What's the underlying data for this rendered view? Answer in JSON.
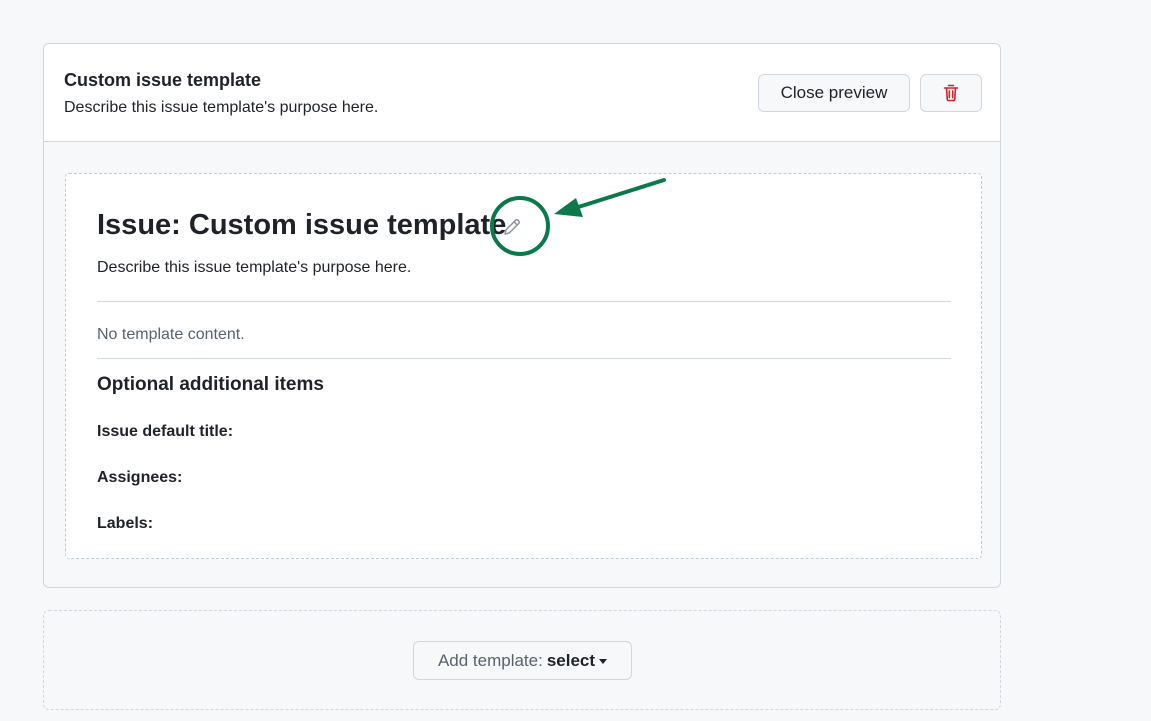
{
  "template": {
    "title": "Custom issue template",
    "description": "Describe this issue template's purpose here.",
    "close_preview_label": "Close preview",
    "delete_icon": "trash-icon"
  },
  "preview": {
    "title": "Issue: Custom issue template",
    "edit_icon": "pencil-icon",
    "description": "Describe this issue template's purpose here.",
    "empty_content": "No template content.",
    "optional_heading": "Optional additional items",
    "fields": {
      "default_title": "Issue default title:",
      "assignees": "Assignees:",
      "labels": "Labels:"
    }
  },
  "add_template": {
    "label": "Add template:",
    "value": "select"
  },
  "colors": {
    "annotation": "#0b7a4b",
    "danger": "#cf222e",
    "border": "#d0d7de"
  }
}
